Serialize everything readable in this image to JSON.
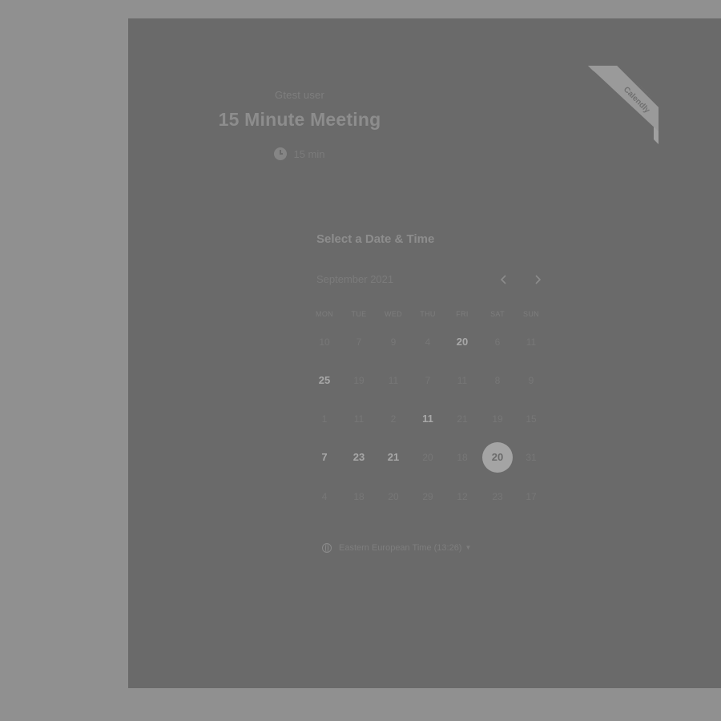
{
  "event": {
    "host": "Gtest user",
    "title": "15 Minute Meeting",
    "duration": "15 min",
    "duration_icon": "clock-icon"
  },
  "badge": {
    "line1": "powered by",
    "line2": "Calendly"
  },
  "picker": {
    "heading": "Select a Date & Time",
    "month": "September 2021",
    "prev_icon": "chevron-left-icon",
    "next_icon": "chevron-right-icon",
    "weekdays": [
      "MON",
      "TUE",
      "WED",
      "THU",
      "FRI",
      "SAT",
      "SUN"
    ],
    "weeks": [
      [
        {
          "label": "10",
          "available": false
        },
        {
          "label": "7",
          "available": false
        },
        {
          "label": "9",
          "available": false
        },
        {
          "label": "4",
          "available": false
        },
        {
          "label": "20",
          "available": true
        },
        {
          "label": "6",
          "available": false
        },
        {
          "label": "11",
          "available": false
        }
      ],
      [
        {
          "label": "25",
          "available": true
        },
        {
          "label": "19",
          "available": false
        },
        {
          "label": "11",
          "available": false
        },
        {
          "label": "7",
          "available": false
        },
        {
          "label": "11",
          "available": false
        },
        {
          "label": "8",
          "available": false
        },
        {
          "label": "9",
          "available": false
        }
      ],
      [
        {
          "label": "1",
          "available": false
        },
        {
          "label": "11",
          "available": false
        },
        {
          "label": "2",
          "available": false
        },
        {
          "label": "11",
          "available": true
        },
        {
          "label": "21",
          "available": false
        },
        {
          "label": "19",
          "available": false
        },
        {
          "label": "15",
          "available": false
        }
      ],
      [
        {
          "label": "7",
          "available": true
        },
        {
          "label": "23",
          "available": true
        },
        {
          "label": "21",
          "available": true
        },
        {
          "label": "20",
          "available": false
        },
        {
          "label": "18",
          "available": false
        },
        {
          "label": "20",
          "available": true,
          "selected": true
        },
        {
          "label": "31",
          "available": false
        }
      ],
      [
        {
          "label": "4",
          "available": false
        },
        {
          "label": "18",
          "available": false
        },
        {
          "label": "20",
          "available": false
        },
        {
          "label": "29",
          "available": false
        },
        {
          "label": "12",
          "available": false
        },
        {
          "label": "23",
          "available": false
        },
        {
          "label": "17",
          "available": false
        }
      ]
    ],
    "timezone": "Eastern European Time (13:26)",
    "timezone_icon": "globe-icon"
  },
  "colors": {
    "page_bg": "#909090",
    "card_bg": "#6a6a6a",
    "selected_bg": "#a4a4a4"
  }
}
